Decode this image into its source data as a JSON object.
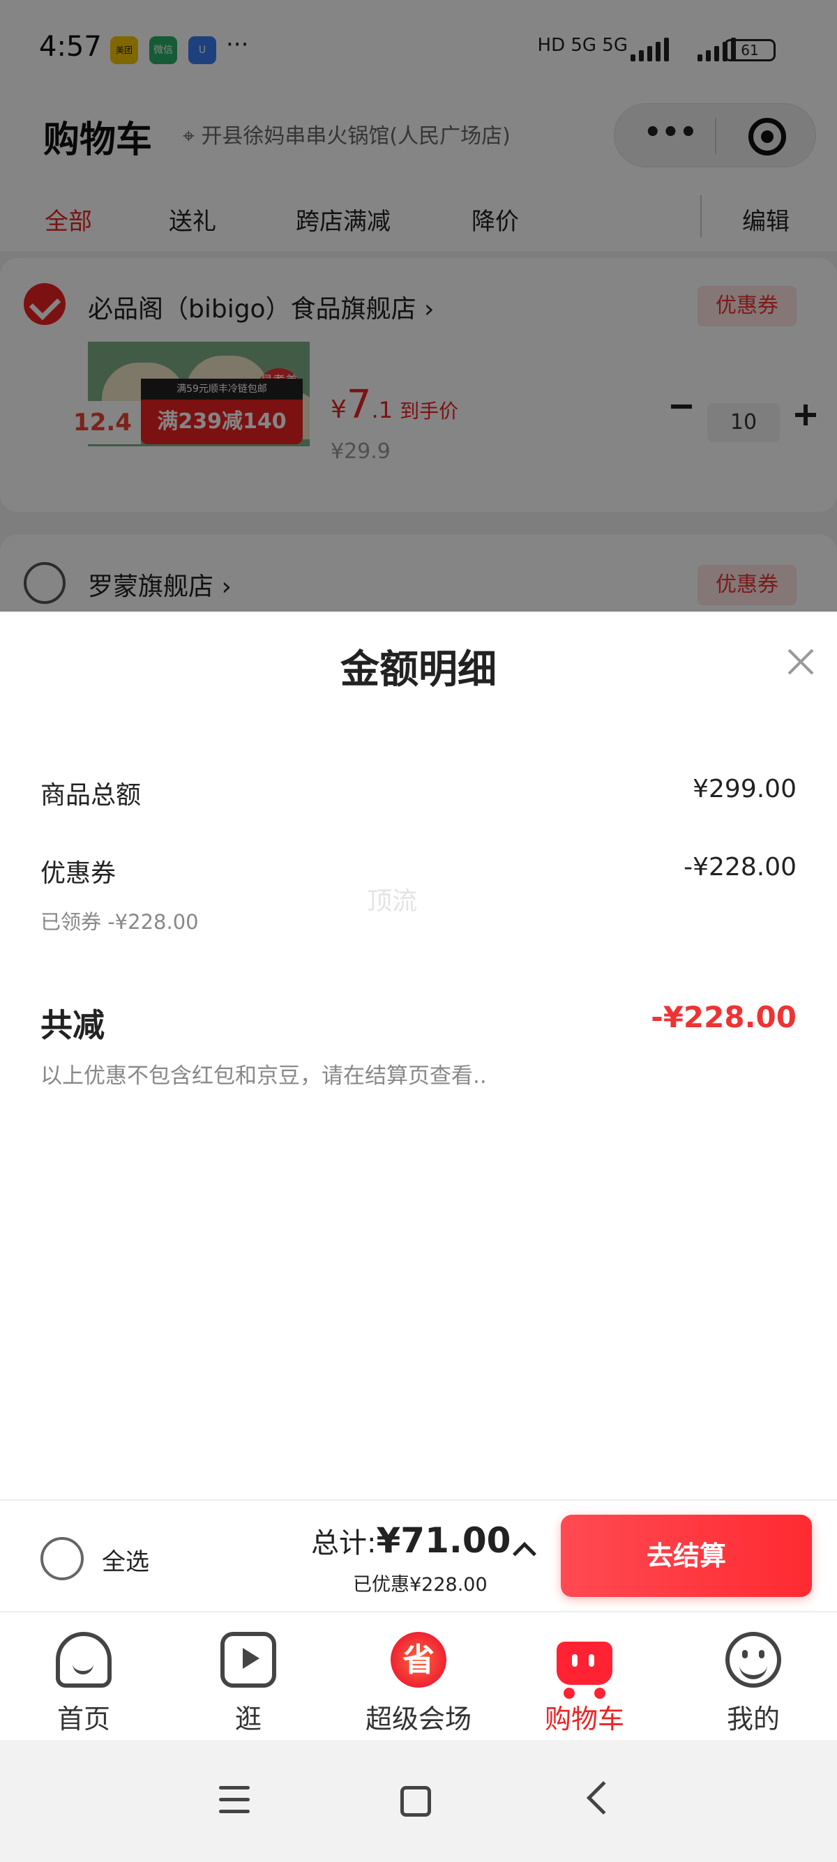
{
  "status_bar": {
    "time": "4:57",
    "apps": [
      "美团",
      "微信",
      "U"
    ],
    "more": "···",
    "network": "HD 5G 5G",
    "battery": "61"
  },
  "header": {
    "title": "购物车",
    "location": "开县徐妈串串火锅馆(人民广场店)",
    "capsule_more": "•••"
  },
  "tabs": {
    "items": [
      "全部",
      "送礼",
      "跨店满减",
      "降价"
    ],
    "active": "全部",
    "edit": "编辑"
  },
  "stores": [
    {
      "name": "必品阁（bibigo）食品旗舰店 ›",
      "coupon": "优惠券",
      "checked": true,
      "item": {
        "promo_price": "12.4",
        "promo_text": "满239减140",
        "promo_small": "满59元顺丰冷链包邮",
        "badge": "易煮美味",
        "price_yen": "¥",
        "price_int": "7",
        "price_dec": ".1",
        "price_tag": "到手价",
        "original_price": "¥29.9",
        "quantity": "10"
      }
    },
    {
      "name": "罗蒙旗舰店 ›",
      "coupon": "优惠券",
      "checked": false
    }
  ],
  "sheet": {
    "title": "金额明细",
    "rows": {
      "goods_total_label": "商品总额",
      "goods_total_value": "¥299.00",
      "coupon_label": "优惠券",
      "coupon_value": "-¥228.00",
      "coupon_sub": "已领券 -¥228.00"
    },
    "total_reduce_label": "共减",
    "total_reduce_value": "-¥228.00",
    "note": "以上优惠不包含红包和京豆，请在结算页查看..",
    "watermark": "顶流"
  },
  "checkout": {
    "select_all": "全选",
    "total_prefix": "总计:",
    "total_amount": "¥71.00",
    "saved": "已优惠¥228.00",
    "button": "去结算"
  },
  "bottom_nav": {
    "items": [
      {
        "label": "首页",
        "icon": "home-icon",
        "active": false
      },
      {
        "label": "逛",
        "icon": "play-icon",
        "active": false
      },
      {
        "label": "超级会场",
        "icon": "sheng-icon",
        "active": false
      },
      {
        "label": "购物车",
        "icon": "cart-icon",
        "active": true
      },
      {
        "label": "我的",
        "icon": "smile-icon",
        "active": false
      }
    ],
    "sheng_char": "省"
  },
  "colors": {
    "accent": "#e22222",
    "checkout_button": "#ff3037",
    "coupon_bg": "#fde5e3"
  }
}
